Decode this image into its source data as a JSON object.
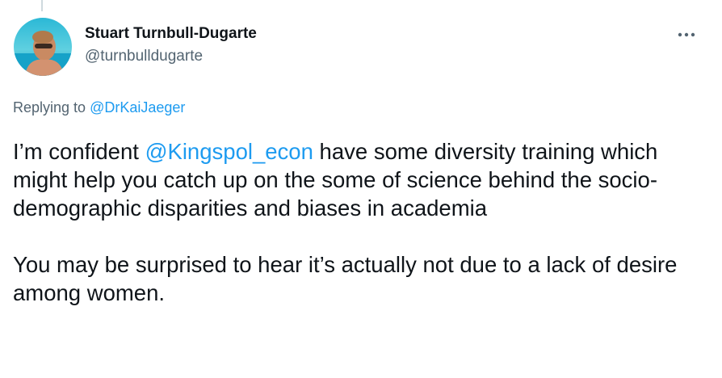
{
  "tweet": {
    "author": {
      "display_name": "Stuart Turnbull-Dugarte",
      "handle": "@turnbulldugarte"
    },
    "more_icon": "more-horizontal-icon",
    "replying_to": {
      "prefix": "Replying to ",
      "mention": "@DrKaiJaeger"
    },
    "body": {
      "paragraph1_before": "I’m confident ",
      "paragraph1_mention": "@Kingspol_econ",
      "paragraph1_after": " have some diversity training which might help you catch up on the some of science behind the socio-demographic disparities and biases in academia",
      "paragraph2": "You may be surprised to hear it’s actually not due to a lack of desire among women."
    }
  },
  "colors": {
    "text": "#0f1419",
    "secondary": "#536471",
    "link": "#1d9bf0",
    "thread_line": "#cfd9de"
  }
}
